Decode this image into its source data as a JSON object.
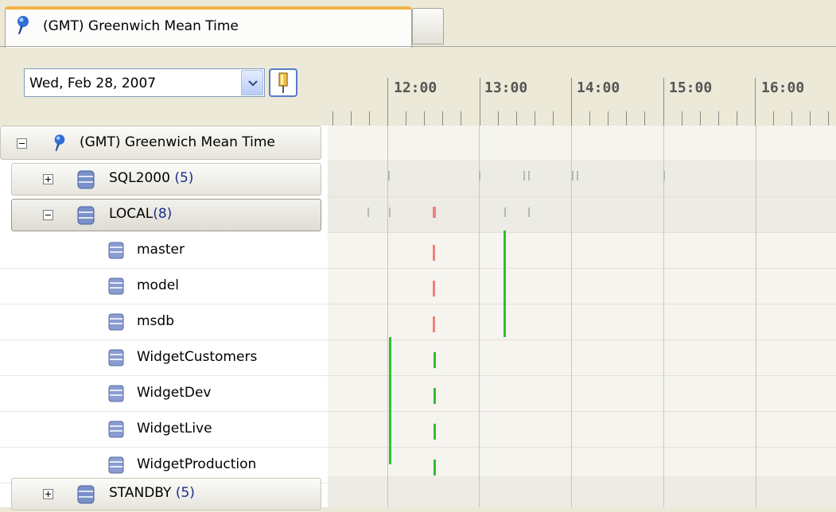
{
  "tab": {
    "label": "(GMT) Greenwich Mean Time",
    "icon": "timezone-pin-icon"
  },
  "date_picker": {
    "value": "Wed, Feb 28, 2007",
    "dropdown_icon": "chevron-down-icon",
    "pin_icon": "pin-icon"
  },
  "timeline": {
    "hours": [
      "12:00",
      "13:00",
      "14:00",
      "15:00",
      "16:00"
    ]
  },
  "tree": {
    "root": {
      "label": "(GMT) Greenwich Mean Time",
      "icon": "timezone-pin-icon"
    },
    "groups": {
      "sql2000": {
        "label": "SQL2000",
        "count": "(5)"
      },
      "local": {
        "label": "LOCAL",
        "count": "(8)"
      },
      "standby": {
        "label": "STANDBY",
        "count": "(5)"
      }
    },
    "databases": [
      "master",
      "model",
      "msdb",
      "WidgetCustomers",
      "WidgetDev",
      "WidgetLive",
      "WidgetProduction"
    ]
  },
  "colors": {
    "success": "#2ec02e",
    "failure": "#f08080",
    "inactive": "#b8b8b8",
    "active_tab": "#f1b447"
  }
}
